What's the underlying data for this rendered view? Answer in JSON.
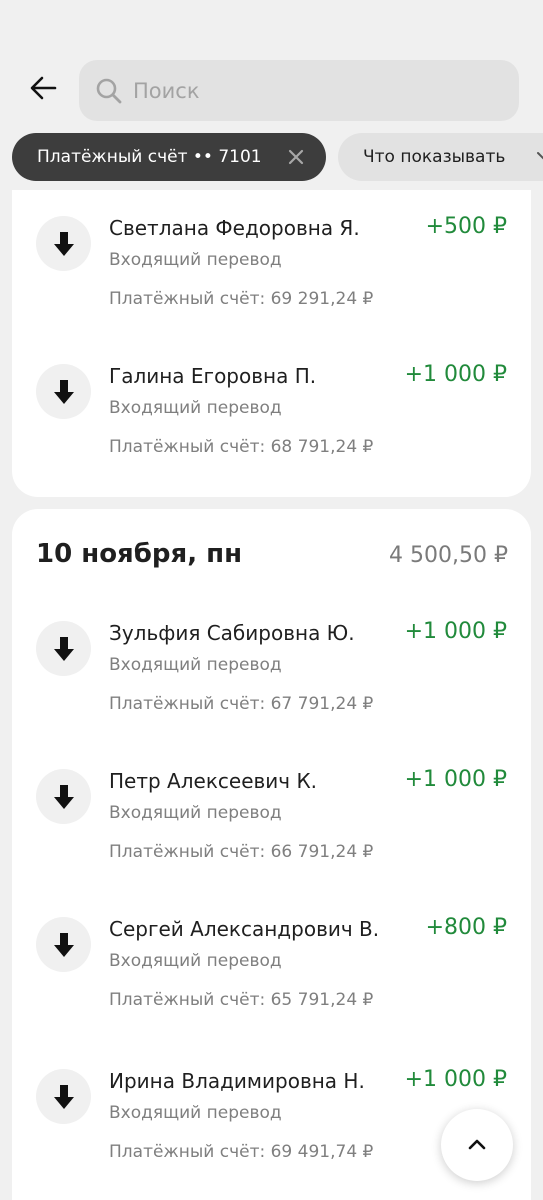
{
  "search": {
    "placeholder": "Поиск"
  },
  "filters": {
    "active_chip": "Платёжный счёт •• 7101",
    "filter_chip": "Что показывать"
  },
  "top_card": {
    "transactions": [
      {
        "name": "Светлана Федоровна Я.",
        "amount": "+500 ₽",
        "type": "Входящий перевод",
        "balance": "Платёжный счёт: 69 291,24 ₽"
      },
      {
        "name": "Галина Егоровна П.",
        "amount": "+1 000 ₽",
        "type": "Входящий перевод",
        "balance": "Платёжный счёт: 68 791,24 ₽"
      }
    ]
  },
  "day": {
    "date": "10 ноября, пн",
    "total": "4 500,50 ₽",
    "transactions": [
      {
        "name": "Зульфия Сабировна Ю.",
        "amount": "+1 000 ₽",
        "type": "Входящий перевод",
        "balance": "Платёжный счёт: 67 791,24 ₽"
      },
      {
        "name": "Петр Алексеевич К.",
        "amount": "+1 000 ₽",
        "type": "Входящий перевод",
        "balance": "Платёжный счёт: 66 791,24 ₽"
      },
      {
        "name": "Сергей Александрович В.",
        "amount": "+800 ₽",
        "type": "Входящий перевод",
        "balance": "Платёжный счёт: 65 791,24 ₽"
      },
      {
        "name": "Ирина Владимировна Н.",
        "amount": "+1 000 ₽",
        "type": "Входящий перевод",
        "balance": "Платёжный счёт: 69 491,74 ₽"
      }
    ]
  },
  "icons": {
    "back": "arrow-left-icon",
    "search": "search-icon",
    "close": "close-icon",
    "chevron": "chevron-down-icon",
    "incoming": "arrow-down-icon",
    "scroll_top": "chevron-up-icon"
  },
  "colors": {
    "amount_positive": "#218a3b",
    "chip_active_bg": "#3d3d3d",
    "background": "#f0f0f0"
  }
}
